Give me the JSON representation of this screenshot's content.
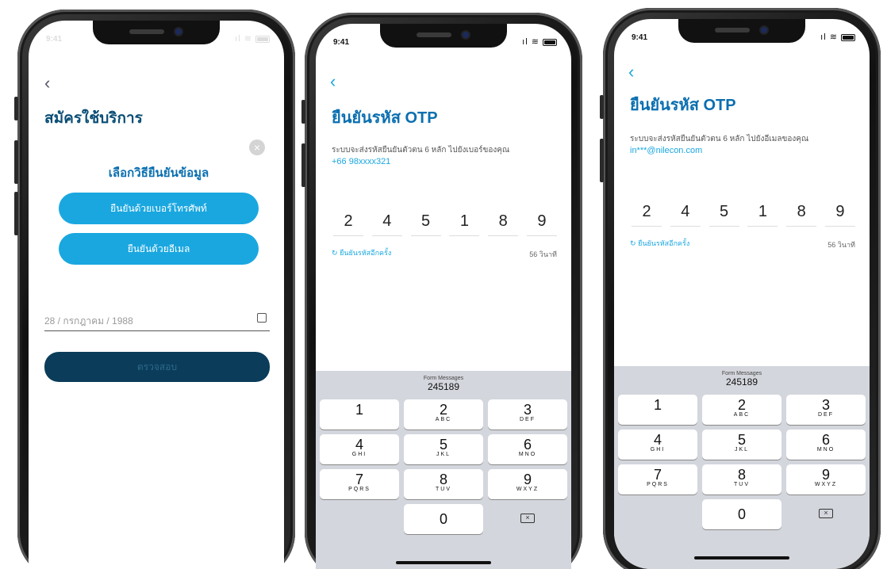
{
  "status_bar": {
    "time": "9:41",
    "signal": "ıl",
    "wifi": "≋"
  },
  "screen1": {
    "page_title": "สมัครใช้บริการ",
    "birthdate": "28 / กรกฎาคม / 1988",
    "submit_label": "ตรวจสอบ",
    "modal": {
      "title": "เลือกวิธียืนยันข้อมูล",
      "close_icon": "×",
      "phone_option": "ยืนยันด้วยเบอร์โทรศัพท์",
      "email_option": "ยืนยันด้วยอีเมล"
    }
  },
  "screen2": {
    "title": "ยืนยันรหัส OTP",
    "description": "ระบบจะส่งรหัสยืนยันตัวตน 6 หลัก ไปยังเบอร์ของคุณ",
    "contact": "+66 98xxxx321",
    "otp_digits": [
      "2",
      "4",
      "5",
      "1",
      "8",
      "9"
    ],
    "resend_label": "ยืนยันรหัสอีกครั้ง",
    "timer": "56 วินาที"
  },
  "screen3": {
    "title": "ยืนยันรหัส OTP",
    "description": "ระบบจะส่งรหัสยืนยันตัวตน 6 หลัก ไปยังอีเมลของคุณ",
    "contact": "in***@nilecon.com",
    "otp_digits": [
      "2",
      "4",
      "5",
      "1",
      "8",
      "9"
    ],
    "resend_label": "ยืนยันรหัสอีกครั้ง",
    "timer": "56 วินาที"
  },
  "keyboard": {
    "suggestion_source": "Form Messages",
    "suggestion_code": "245189",
    "keys": [
      {
        "n": "1",
        "l": ""
      },
      {
        "n": "2",
        "l": "ABC"
      },
      {
        "n": "3",
        "l": "DEF"
      },
      {
        "n": "4",
        "l": "GHI"
      },
      {
        "n": "5",
        "l": "JKL"
      },
      {
        "n": "6",
        "l": "MNO"
      },
      {
        "n": "7",
        "l": "PQRS"
      },
      {
        "n": "8",
        "l": "TUV"
      },
      {
        "n": "9",
        "l": "WXYZ"
      }
    ],
    "zero": "0",
    "delete_icon": "⌫"
  },
  "icons": {
    "back": "chevron-left-icon",
    "resend": "refresh-icon",
    "delete": "backspace-icon",
    "close": "close-icon",
    "calendar": "calendar-icon"
  },
  "colors": {
    "accent": "#1aa7e0",
    "title": "#0a6fb0",
    "keyboard_bg": "#d3d6dc"
  }
}
